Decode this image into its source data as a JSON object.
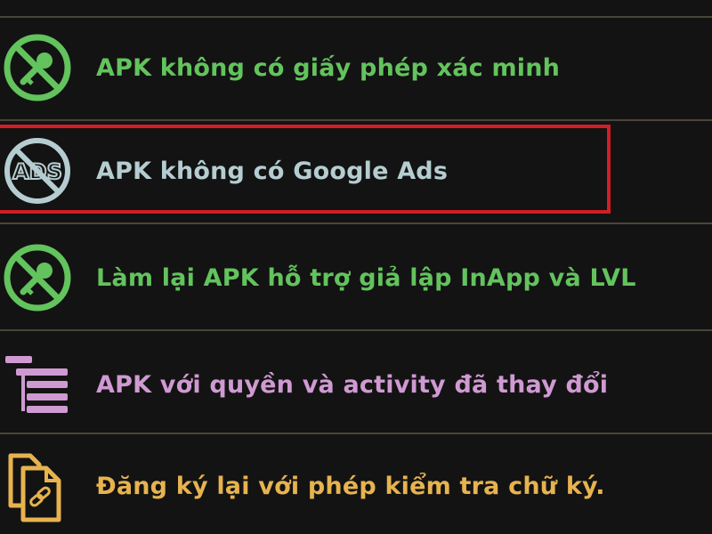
{
  "menu": {
    "items": [
      {
        "label": "APK không có giấy phép xác minh",
        "icon": "no-license-icon",
        "color": "#63c35d"
      },
      {
        "label": "APK không có Google Ads",
        "icon": "no-ads-icon",
        "color": "#b5cdd0"
      },
      {
        "label": "Làm lại APK hỗ trợ giả lập InApp và LVL",
        "icon": "no-license-icon",
        "color": "#63c35d"
      },
      {
        "label": "APK với quyền và activity đã thay đổi",
        "icon": "permissions-list-icon",
        "color": "#cf9ad2"
      },
      {
        "label": "Đăng ký lại với phép kiểm tra chữ ký.",
        "icon": "copy-link-icon",
        "color": "#e7b34f"
      }
    ]
  },
  "colors": {
    "background": "#131313",
    "divider": "#4a4637",
    "highlight_border": "#d21d24"
  }
}
